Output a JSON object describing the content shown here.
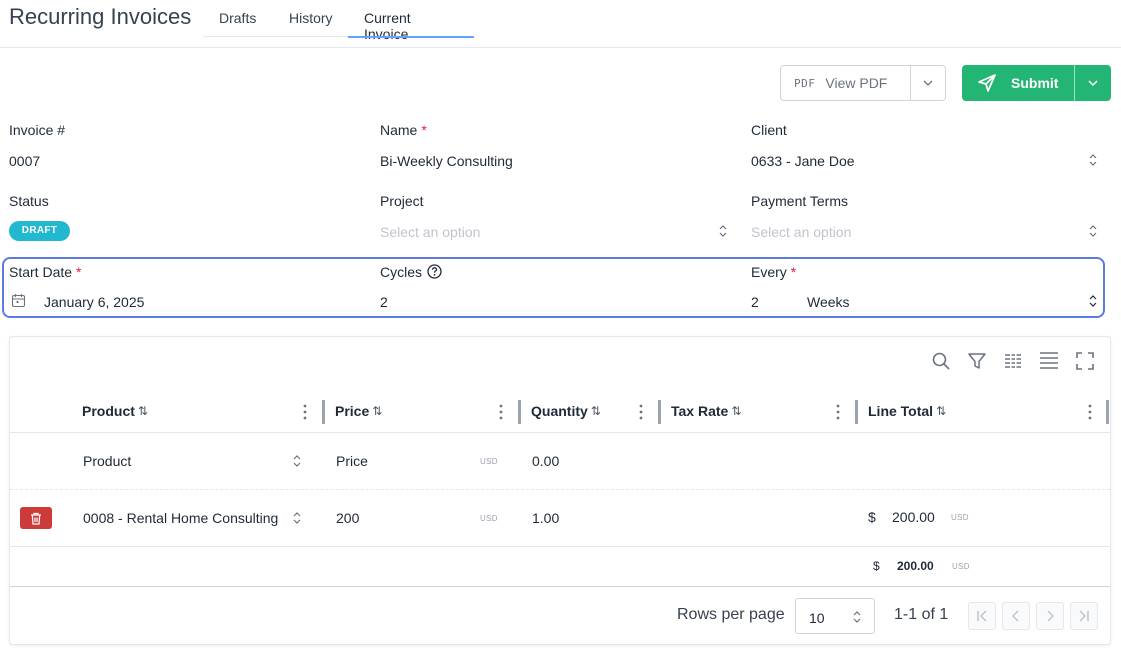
{
  "header": {
    "title": "Recurring Invoices",
    "tabs": [
      {
        "label": "Drafts"
      },
      {
        "label": "History"
      },
      {
        "label": "Current Invoice"
      }
    ]
  },
  "toolbar": {
    "pdf_glyph": "PDF",
    "view_pdf_label": "View PDF",
    "submit_label": "Submit"
  },
  "form": {
    "invoice_number": {
      "label": "Invoice #",
      "value": "0007"
    },
    "name": {
      "label": "Name",
      "required_mark": "*",
      "value": "Bi-Weekly Consulting"
    },
    "client": {
      "label": "Client",
      "value": "0633 - Jane Doe"
    },
    "status": {
      "label": "Status",
      "value": "DRAFT"
    },
    "project": {
      "label": "Project",
      "placeholder": "Select an option"
    },
    "payment_terms": {
      "label": "Payment Terms",
      "placeholder": "Select an option"
    },
    "start_date": {
      "label": "Start Date",
      "required_mark": "*",
      "value": "January 6, 2025"
    },
    "cycles": {
      "label": "Cycles",
      "value": "2"
    },
    "every": {
      "label": "Every",
      "required_mark": "*",
      "value": "2",
      "unit": "Weeks"
    }
  },
  "table": {
    "columns": [
      {
        "label": "Product",
        "sort": "⇅"
      },
      {
        "label": "Price",
        "sort": "⇅"
      },
      {
        "label": "Quantity",
        "sort": "⇅"
      },
      {
        "label": "Tax Rate",
        "sort": "⇅"
      },
      {
        "label": "Line Total",
        "sort": "⇅"
      }
    ],
    "new_row": {
      "product_placeholder": "Product",
      "price_placeholder": "Price",
      "price_unit": "USD",
      "quantity": "0.00"
    },
    "rows": [
      {
        "product": "0008 - Rental Home Consulting",
        "price": "200",
        "price_unit": "USD",
        "quantity": "1.00",
        "line_total_symbol": "$",
        "line_total": "200.00",
        "line_total_unit": "USD"
      }
    ],
    "total": {
      "symbol": "$",
      "value": "200.00",
      "unit": "USD"
    },
    "footer": {
      "rows_per_page_label": "Rows per page",
      "rows_per_page_value": "10",
      "range_label": "1-1 of 1"
    }
  },
  "icons": [
    "pdf-icon",
    "send-icon",
    "chevron-down-icon",
    "updown-icon",
    "calendar-icon",
    "help-icon",
    "search-icon",
    "filter-icon",
    "columns-icon",
    "density-icon",
    "fullscreen-icon",
    "trash-icon",
    "first-page-icon",
    "prev-page-icon",
    "next-page-icon",
    "last-page-icon"
  ],
  "colors": {
    "accent_tab": "#60a5fa",
    "submit_green": "#22b573",
    "draft_badge": "#22b8cf",
    "highlight_border": "#5b7be0",
    "delete_red": "#cc3a3a",
    "required_red": "#e11d48"
  }
}
